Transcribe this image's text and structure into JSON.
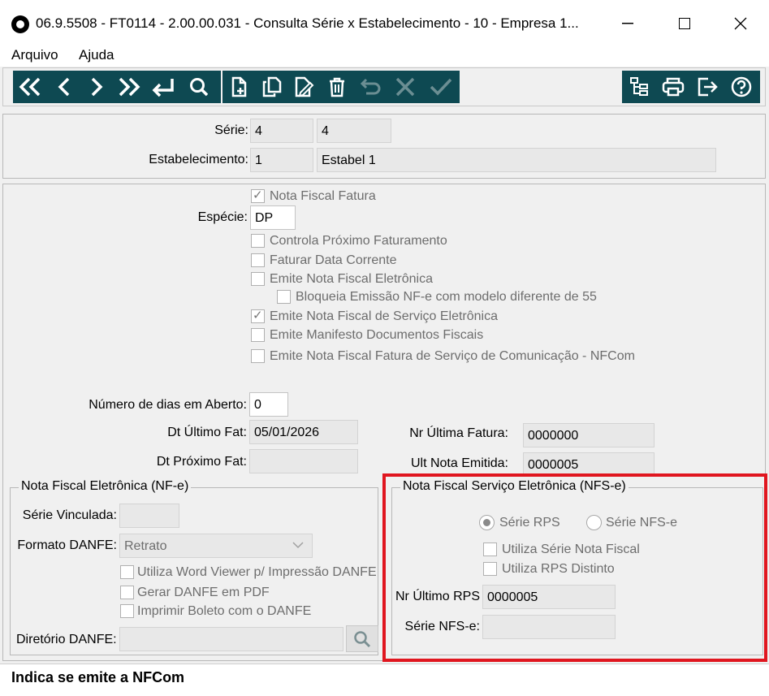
{
  "window": {
    "title": "06.9.5508 - FT0114 - 2.00.00.031 - Consulta Série x Estabelecimento - 10 - Empresa 1..."
  },
  "menu": {
    "arquivo": "Arquivo",
    "ajuda": "Ajuda"
  },
  "toolbar": {
    "nav_icons": [
      "first-icon",
      "previous-icon",
      "next-icon",
      "last-icon",
      "goto-icon",
      "search-icon"
    ],
    "edit_icons": [
      "new-icon",
      "copy-icon",
      "edit-icon",
      "delete-icon",
      "undo-icon",
      "cancel-icon",
      "confirm-icon"
    ],
    "right_icons": [
      "tree-icon",
      "print-icon",
      "exit-icon",
      "help-icon"
    ]
  },
  "header": {
    "serie_label": "Série:",
    "serie_value": "4",
    "serie_desc": "4",
    "estab_label": "Estabelecimento:",
    "estab_value": "1",
    "estab_desc": "Estabel 1"
  },
  "options": {
    "nota_fiscal_fatura": "Nota Fiscal Fatura",
    "especie_label": "Espécie:",
    "especie_value": "DP",
    "controla_proximo": "Controla Próximo Faturamento",
    "faturar_data": "Faturar Data Corrente",
    "emite_nfe": "Emite Nota Fiscal Eletrônica",
    "bloqueia_nfe": "Bloqueia Emissão NF-e com modelo diferente de 55",
    "emite_nfse": "Emite Nota Fiscal de Serviço Eletrônica",
    "emite_mdfe": "Emite Manifesto Documentos Fiscais",
    "emite_nfcom": "Emite Nota Fiscal Fatura de Serviço de Comunicação - NFCom"
  },
  "dates": {
    "dias_aberto_label": "Número de dias em Aberto:",
    "dias_aberto_value": "0",
    "dt_ultimo_label": "Dt Último Fat:",
    "dt_ultimo_value": "05/01/2026",
    "dt_proximo_label": "Dt Próximo Fat:",
    "dt_proximo_value": "",
    "nr_ultima_fatura_label": "Nr Última Fatura:",
    "nr_ultima_fatura_value": "0000000",
    "ult_nota_label": "Ult Nota Emitida:",
    "ult_nota_value": "0000005"
  },
  "nfe": {
    "title": "Nota Fiscal Eletrônica (NF-e)",
    "serie_vinculada_label": "Série Vinculada:",
    "serie_vinculada_value": "",
    "formato_label": "Formato DANFE:",
    "formato_value": "Retrato",
    "word_viewer": "Utiliza Word Viewer p/ Impressão DANFE",
    "gerar_pdf": "Gerar DANFE em PDF",
    "imprimir_boleto": "Imprimir Boleto com o DANFE",
    "diretorio_label": "Diretório DANFE:",
    "diretorio_value": ""
  },
  "nfse": {
    "title": "Nota Fiscal Serviço Eletrônica (NFS-e)",
    "serie_rps": "Série RPS",
    "serie_nfse_radio": "Série NFS-e",
    "utiliza_serie_nf": "Utiliza Série Nota Fiscal",
    "utiliza_rps_distinto": "Utiliza RPS Distinto",
    "nr_ultimo_rps_label": "Nr Último RPS",
    "nr_ultimo_rps_value": "0000005",
    "serie_nfse_label": "Série NFS-e:",
    "serie_nfse_value": ""
  },
  "status": {
    "text": "Indica se emite a NFCom"
  },
  "colors": {
    "toolbar_bg": "#0e4952",
    "highlight": "#e0161f"
  }
}
